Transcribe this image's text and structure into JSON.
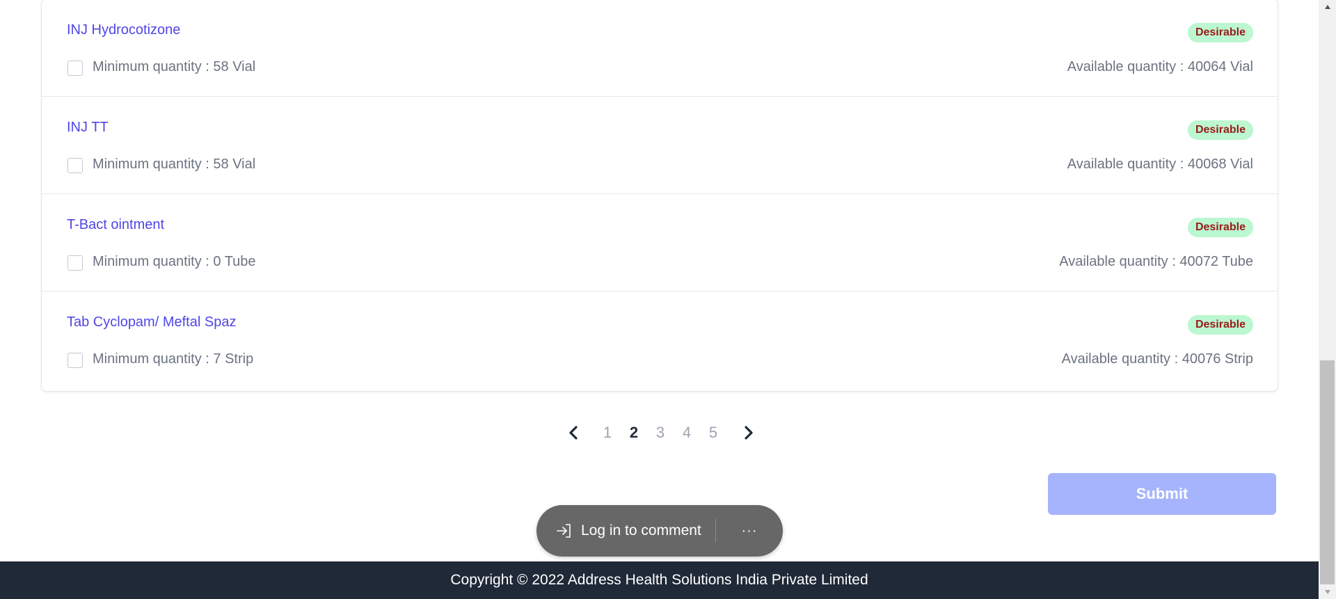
{
  "items": [
    {
      "name": "INJ Hydrocotizone",
      "badge": "Desirable",
      "min_qty": "Minimum quantity : 58 Vial",
      "avail_qty": "Available quantity : 40064 Vial"
    },
    {
      "name": "INJ TT",
      "badge": "Desirable",
      "min_qty": "Minimum quantity : 58 Vial",
      "avail_qty": "Available quantity : 40068 Vial"
    },
    {
      "name": "T-Bact ointment",
      "badge": "Desirable",
      "min_qty": "Minimum quantity : 0 Tube",
      "avail_qty": "Available quantity : 40072 Tube"
    },
    {
      "name": "Tab Cyclopam/ Meftal Spaz",
      "badge": "Desirable",
      "min_qty": "Minimum quantity : 7 Strip",
      "avail_qty": "Available quantity : 40076 Strip"
    }
  ],
  "pagination": {
    "pages": [
      "1",
      "2",
      "3",
      "4",
      "5"
    ],
    "current": "2",
    "prev_icon": "chevron-left-icon",
    "next_icon": "chevron-right-icon"
  },
  "submit_label": "Submit",
  "comment": {
    "login_label": "Log in to comment",
    "more_label": "···",
    "login_icon": "login-arrow-icon"
  },
  "footer": {
    "copyright": "Copyright © 2022 Address Health Solutions India Private Limited"
  },
  "colors": {
    "accent": "#4f46e5",
    "badge_bg": "#bbf7d0",
    "badge_text": "#991b1b",
    "submit_bg": "#a5b4fc",
    "footer_bg": "#1f2937"
  }
}
